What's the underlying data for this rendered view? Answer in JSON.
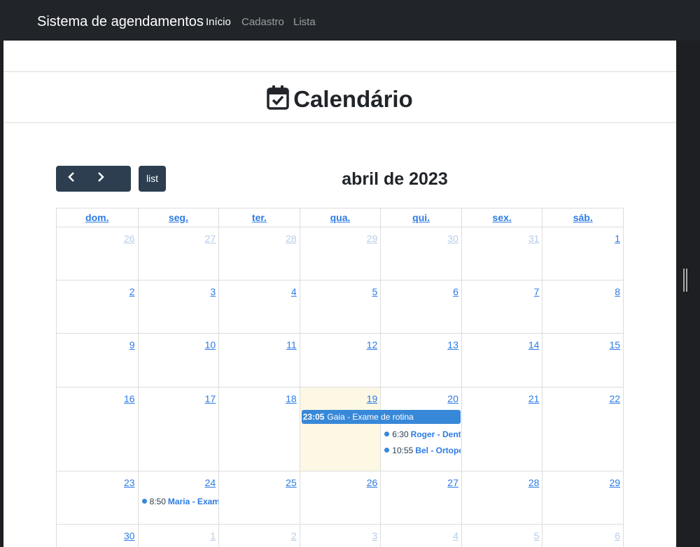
{
  "navbar": {
    "brand": "Sistema de agendamentos",
    "links": [
      {
        "label": "Início",
        "active": true
      },
      {
        "label": "Cadastro",
        "active": false
      },
      {
        "label": "Lista",
        "active": false
      }
    ]
  },
  "page": {
    "heading": "Calendário",
    "heading_icon": "calendar-check-icon"
  },
  "toolbar": {
    "prev_icon": "chevron-left-icon",
    "next_icon": "chevron-right-icon",
    "list_label": "list",
    "title": "abril de 2023"
  },
  "calendar": {
    "weekdays": [
      "dom.",
      "seg.",
      "ter.",
      "qua.",
      "qui.",
      "sex.",
      "sáb."
    ],
    "weeks": [
      {
        "days": [
          {
            "num": "26",
            "other": true
          },
          {
            "num": "27",
            "other": true
          },
          {
            "num": "28",
            "other": true
          },
          {
            "num": "29",
            "other": true
          },
          {
            "num": "30",
            "other": true
          },
          {
            "num": "31",
            "other": true
          },
          {
            "num": "1",
            "other": false
          }
        ]
      },
      {
        "days": [
          {
            "num": "2",
            "other": false
          },
          {
            "num": "3",
            "other": false
          },
          {
            "num": "4",
            "other": false
          },
          {
            "num": "5",
            "other": false
          },
          {
            "num": "6",
            "other": false
          },
          {
            "num": "7",
            "other": false
          },
          {
            "num": "8",
            "other": false
          }
        ]
      },
      {
        "days": [
          {
            "num": "9",
            "other": false
          },
          {
            "num": "10",
            "other": false
          },
          {
            "num": "11",
            "other": false
          },
          {
            "num": "12",
            "other": false
          },
          {
            "num": "13",
            "other": false
          },
          {
            "num": "14",
            "other": false
          },
          {
            "num": "15",
            "other": false
          }
        ]
      },
      {
        "days": [
          {
            "num": "16",
            "other": false
          },
          {
            "num": "17",
            "other": false
          },
          {
            "num": "18",
            "other": false
          },
          {
            "num": "19",
            "other": false,
            "today": true
          },
          {
            "num": "20",
            "other": false
          },
          {
            "num": "21",
            "other": false
          },
          {
            "num": "22",
            "other": false
          }
        ]
      },
      {
        "days": [
          {
            "num": "23",
            "other": false
          },
          {
            "num": "24",
            "other": false
          },
          {
            "num": "25",
            "other": false
          },
          {
            "num": "26",
            "other": false
          },
          {
            "num": "27",
            "other": false
          },
          {
            "num": "28",
            "other": false
          },
          {
            "num": "29",
            "other": false
          }
        ]
      },
      {
        "days": [
          {
            "num": "30",
            "other": false
          },
          {
            "num": "1",
            "other": true
          },
          {
            "num": "2",
            "other": true
          },
          {
            "num": "3",
            "other": true
          },
          {
            "num": "4",
            "other": true
          },
          {
            "num": "5",
            "other": true
          },
          {
            "num": "6",
            "other": true
          }
        ]
      }
    ],
    "events": {
      "gaia": {
        "time": "23:05",
        "title": "Gaia - Exame de rotina"
      },
      "roger": {
        "time": "6:30",
        "title": "Roger - Dentista"
      },
      "bel": {
        "time": "10:55",
        "title": "Bel - Ortopedista"
      },
      "maria": {
        "time": "8:50",
        "title": "Maria - Exame"
      }
    },
    "colors": {
      "event": "#3788d8",
      "today": "#fcf8e3",
      "link": "#2c7be5"
    }
  }
}
